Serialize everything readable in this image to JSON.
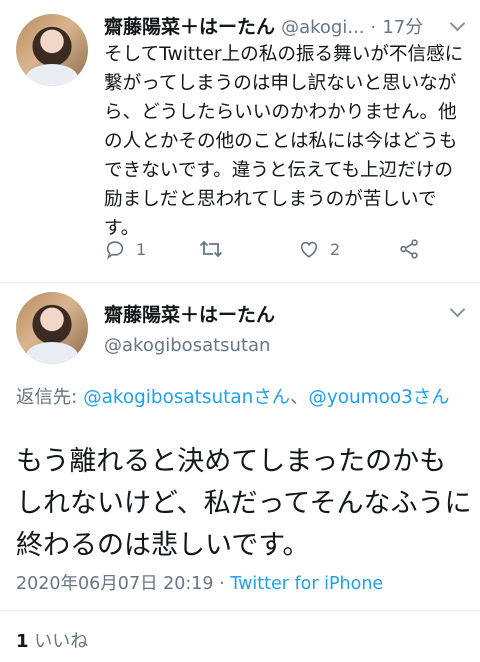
{
  "tweet1": {
    "display_name": "齋藤陽菜＋はーたん",
    "handle": "@akogi...",
    "separator": "·",
    "time": "17分",
    "text": "そしてTwitter上の私の振る舞いが不信感に繋がってしまうのは申し訳ないと思いながら、どうしたらいいのかわかりません。他の人とかその他のことは私には今はどうもできないです。違うと伝えても上辺だけの励ましだと思われてしまうのが苦しいです。",
    "actions": {
      "reply_icon": "reply-icon",
      "reply_count": "1",
      "retweet_icon": "retweet-icon",
      "like_icon": "heart-icon",
      "like_count": "2",
      "share_icon": "share-icon"
    }
  },
  "tweet2": {
    "display_name": "齋藤陽菜＋はーたん",
    "handle": "@akogibosatsutan",
    "reply_prefix": "返信先: ",
    "reply_to_1": "@akogibosatsutanさん",
    "reply_sep": "、",
    "reply_to_2": "@youmoo3さん",
    "text": "もう離れると決めてしまったのかもしれないけど、私だってそんなふうに終わるのは悲しいです。",
    "timestamp": "2020年06月07日 20:19",
    "meta_sep": " · ",
    "source": "Twitter for iPhone",
    "like_count": "1",
    "like_label": "いいね"
  },
  "colors": {
    "accent": "#1da1f2",
    "secondary_text": "#657786",
    "primary_text": "#14171a",
    "divider": "#e6ecf0"
  }
}
